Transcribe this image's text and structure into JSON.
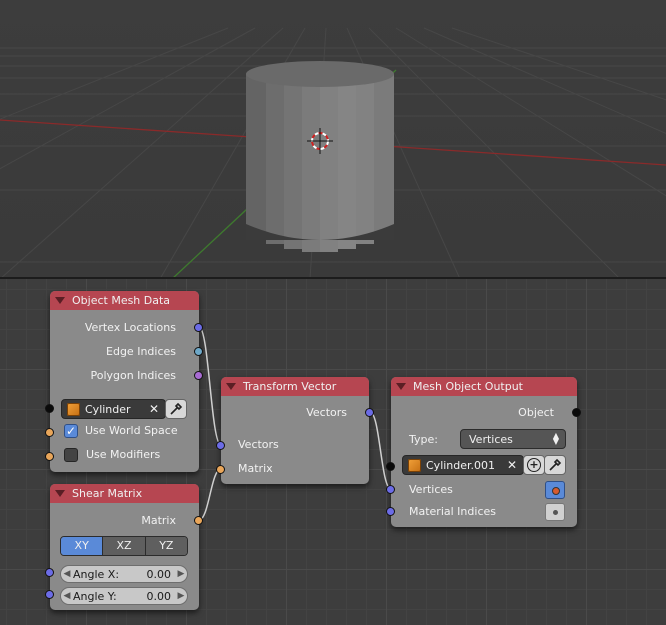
{
  "nodes": {
    "object_mesh_data": {
      "title": "Object Mesh Data",
      "outputs": [
        "Vertex Locations",
        "Edge Indices",
        "Polygon Indices"
      ],
      "object_field": "Cylinder",
      "use_world_space": "Use World Space",
      "use_modifiers": "Use Modifiers"
    },
    "transform_vector": {
      "title": "Transform Vector",
      "output": "Vectors",
      "inputs": [
        "Vectors",
        "Matrix"
      ]
    },
    "shear_matrix": {
      "title": "Shear Matrix",
      "output": "Matrix",
      "plane_options": [
        "XY",
        "XZ",
        "YZ"
      ],
      "angle_x_label": "Angle X:",
      "angle_x_value": "0.00",
      "angle_y_label": "Angle Y:",
      "angle_y_value": "0.00"
    },
    "mesh_object_output": {
      "title": "Mesh Object Output",
      "output": "Object",
      "type_label": "Type:",
      "type_value": "Vertices",
      "object_field": "Cylinder.001",
      "inputs": [
        "Vertices",
        "Material Indices"
      ]
    }
  },
  "colors": {
    "node_header": "#b64651",
    "node_body": "#8a8a8a",
    "socket_vector": "#6c6ce6",
    "socket_matrix": "#e9a65a",
    "accent": "#5a8ad8"
  }
}
